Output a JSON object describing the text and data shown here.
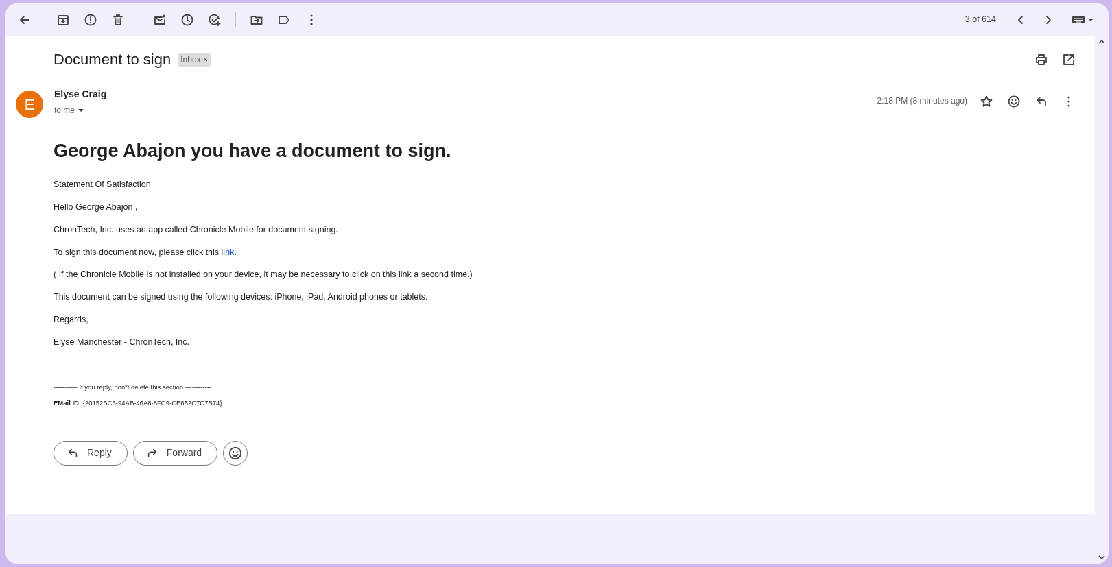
{
  "toolbar": {
    "counter": "3 of 614"
  },
  "subject": "Document to sign",
  "labels": [
    {
      "text": "Inbox",
      "remove": "×"
    }
  ],
  "message": {
    "avatar": "E",
    "sender": "Elyse Craig",
    "recipient": "to me",
    "time": "2:18 PM (8 minutes ago)",
    "starred": false
  },
  "body": {
    "heading": "George Abajon you have a document to sign.",
    "paragraphs": [
      {
        "text": "Statement Of Satisfaction"
      },
      {
        "text": "Hello George Abajon ,"
      },
      {
        "text": "ChronTech, Inc. uses an app called Chronicle Mobile for document signing."
      },
      {
        "text": "To sign this document now, please click this ",
        "link": "link",
        "after": "."
      },
      {
        "text": "( If the Chronicle Mobile is not installed on your device, it may be necessary to click on this link a second time.)"
      },
      {
        "text": "This document can be signed using the following devices: iPhone, iPad, Android phones or tablets."
      },
      {
        "text": "Regards,"
      },
      {
        "text": "Elyse Manchester - ChronTech, Inc."
      }
    ],
    "footer": [
      "----------- If you reply, don\"t delete this section ------------",
      "**EMail ID:** {20152BC6-94AB-46A8-8FC9-CE652C7C7B74}"
    ]
  },
  "actions": [
    "Reply",
    "Forward"
  ]
}
